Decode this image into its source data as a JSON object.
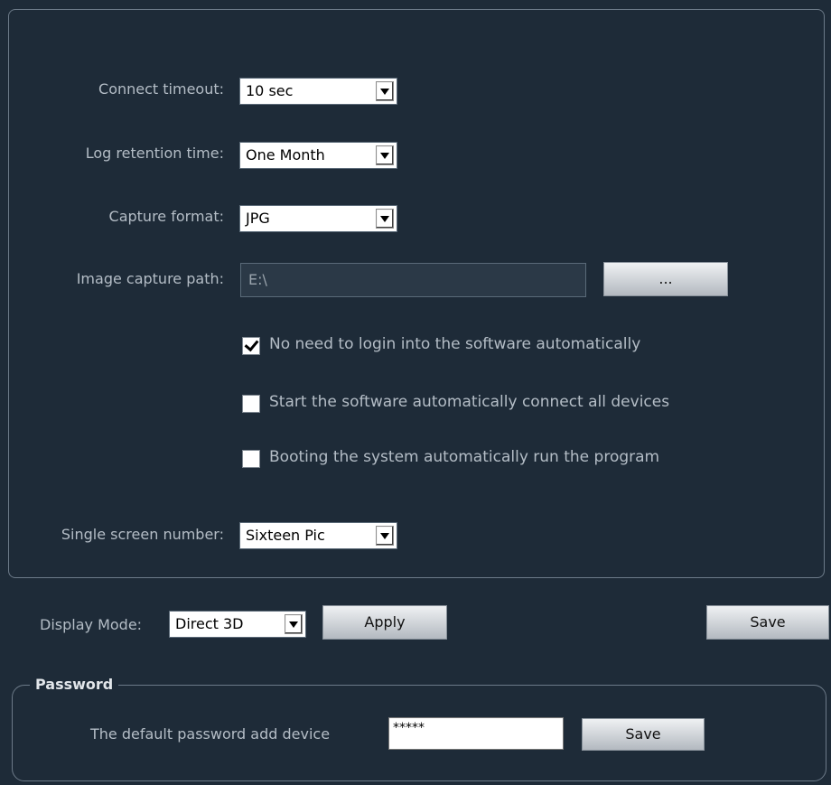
{
  "settings": {
    "connect_timeout": {
      "label": "Connect timeout:",
      "value": "10 sec"
    },
    "log_retention": {
      "label": "Log retention time:",
      "value": "One Month"
    },
    "capture_format": {
      "label": "Capture format:",
      "value": "JPG"
    },
    "image_capture_path": {
      "label": "Image capture path:",
      "value": "E:\\",
      "browse_label": "..."
    },
    "checkboxes": [
      {
        "label": "No need to login into the software automatically",
        "checked": true
      },
      {
        "label": "Start the software automatically connect all devices",
        "checked": false
      },
      {
        "label": "Booting the system automatically run the program",
        "checked": false
      }
    ],
    "single_screen_number": {
      "label": "Single screen number:",
      "value": "Sixteen Pic"
    }
  },
  "display": {
    "label": "Display Mode:",
    "value": "Direct 3D",
    "apply_label": "Apply",
    "save_label": "Save"
  },
  "password": {
    "legend": "Password",
    "label": "The default password add device",
    "value": "*****",
    "save_label": "Save"
  }
}
